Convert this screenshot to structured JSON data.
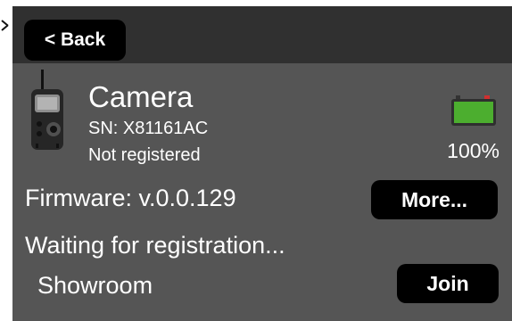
{
  "top_bar": {
    "back_label": "< Back"
  },
  "device": {
    "name": "Camera",
    "serial": "SN: X81161AC",
    "status": "Not registered",
    "icon": "camera-icon"
  },
  "battery": {
    "percent": "100%",
    "level": 1.0,
    "color": "#4cae2f",
    "icon": "battery-icon"
  },
  "firmware": {
    "label": "Firmware: v.0.0.129",
    "more_label": "More..."
  },
  "registration": {
    "message": "Waiting for registration..."
  },
  "network": {
    "name": "Showroom",
    "join_label": "Join"
  },
  "colors": {
    "background": "#555555",
    "top_bar": "#303030",
    "button": "#000000",
    "text": "#ffffff"
  }
}
